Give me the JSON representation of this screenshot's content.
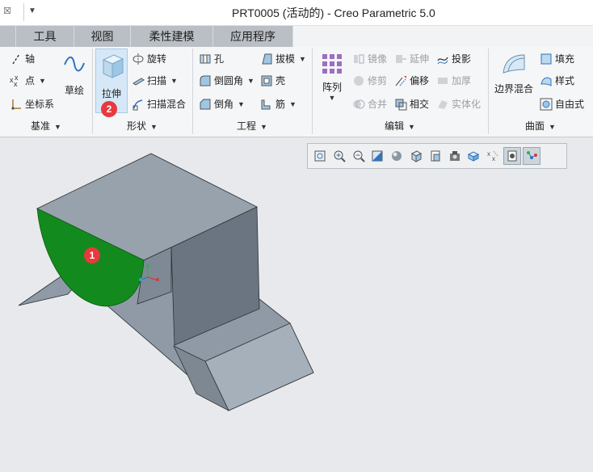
{
  "window": {
    "title": "PRT0005 (活动的) - Creo Parametric 5.0",
    "quick_access_close": "☒",
    "quick_access_menu": "▼"
  },
  "tabs": [
    {
      "label": "工具"
    },
    {
      "label": "视图"
    },
    {
      "label": "柔性建模"
    },
    {
      "label": "应用程序"
    }
  ],
  "ribbon": {
    "datum": {
      "axis": "轴",
      "point": "点",
      "csys": "坐标系",
      "sketch": "草绘",
      "footer": "基准"
    },
    "shapes": {
      "extrude": "拉伸",
      "revolve": "旋转",
      "sweep": "扫描",
      "swept_blend": "扫描混合",
      "footer": "形状"
    },
    "engineering": {
      "hole": "孔",
      "round": "倒圆角",
      "chamfer": "倒角",
      "draft": "拔模",
      "shell": "壳",
      "rib": "筋",
      "footer": "工程"
    },
    "editing": {
      "pattern": "阵列",
      "mirror": "镜像",
      "extend": "延伸",
      "project": "投影",
      "trim": "修剪",
      "offset": "偏移",
      "thicken": "加厚",
      "merge": "合并",
      "intersect": "相交",
      "solidify": "实体化",
      "footer": "编辑"
    },
    "surfaces": {
      "boundary_blend": "边界混合",
      "fill": "填充",
      "style": "样式",
      "freestyle": "自由式",
      "footer": "曲面"
    }
  },
  "annotations": {
    "badge_1": "1",
    "badge_2": "2"
  },
  "colors": {
    "accent_blue": "#2f74c0",
    "selected_face": "#138a1d",
    "model_gray": "#8e98a4",
    "badge_red": "#e8393e"
  }
}
